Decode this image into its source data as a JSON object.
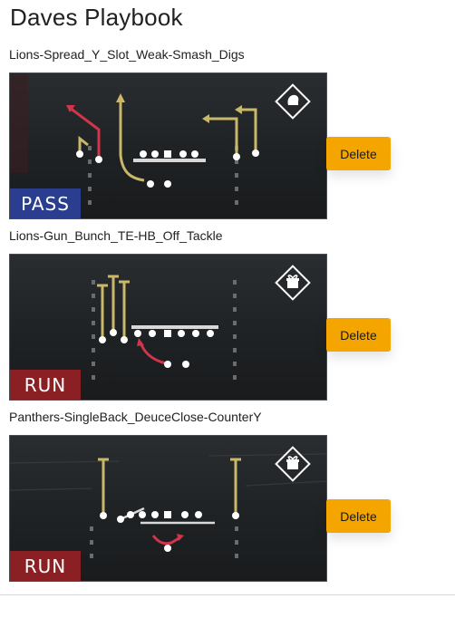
{
  "page": {
    "title": "Daves Playbook"
  },
  "plays": [
    {
      "name": "Lions-Spread_Y_Slot_Weak-Smash_Digs",
      "type": "PASS",
      "delete_label": "Delete",
      "icon": "helmet-icon"
    },
    {
      "name": "Lions-Gun_Bunch_TE-HB_Off_Tackle",
      "type": "RUN",
      "delete_label": "Delete",
      "icon": "gift-icon"
    },
    {
      "name": "Panthers-SingleBack_DeuceClose-CounterY",
      "type": "RUN",
      "delete_label": "Delete",
      "icon": "gift-icon"
    }
  ],
  "colors": {
    "route_gold": "#c9b86a",
    "route_red": "#d0354a",
    "pass_badge": "#2b3d8f",
    "run_badge": "#8a1f24",
    "delete_button": "#f5a500"
  }
}
